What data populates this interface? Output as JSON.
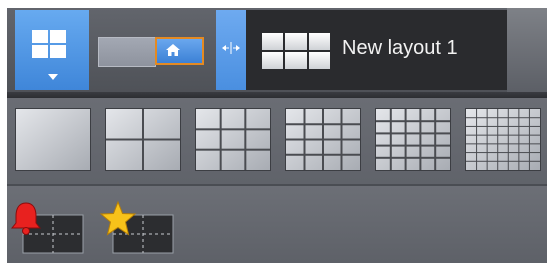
{
  "topbar": {
    "layout_button_icon": "four-pane-grid-icon",
    "dropdown_icon": "chevron-down-icon",
    "toggle": {
      "left_icon": "view-icon",
      "right_icon": "home-icon"
    },
    "splitter_icon": "resize-horizontal-icon",
    "tab": {
      "icon": "six-pane-grid-icon",
      "title": "New layout 1"
    }
  },
  "grid_options": [
    {
      "name": "grid-1x1-option",
      "cols": 1,
      "rows": 1
    },
    {
      "name": "grid-2x2-option",
      "cols": 2,
      "rows": 2
    },
    {
      "name": "grid-3x3-option",
      "cols": 3,
      "rows": 3
    },
    {
      "name": "grid-4x4-option",
      "cols": 4,
      "rows": 4
    },
    {
      "name": "grid-5x5-option",
      "cols": 5,
      "rows": 5
    },
    {
      "name": "grid-7x7-option",
      "cols": 7,
      "rows": 7
    }
  ],
  "special_layouts": [
    {
      "name": "alarm-layout",
      "icon": "bell-icon",
      "color": "#e8211f"
    },
    {
      "name": "favorites-layout",
      "icon": "star-icon",
      "color": "#f7c21a"
    }
  ],
  "colors": {
    "accent_blue": "#4a8fe0",
    "active_border": "#e48a22",
    "panel_bg": "#5a5d64"
  }
}
